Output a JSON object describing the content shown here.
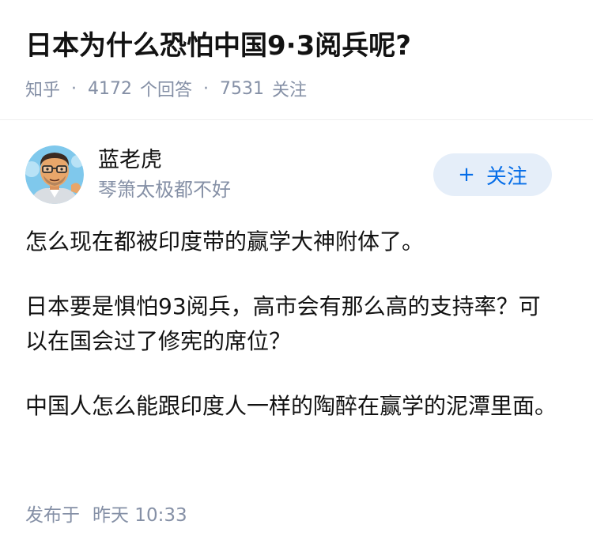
{
  "question": {
    "title": "日本为什么恐怕中国9·3阅兵呢?",
    "source": "知乎",
    "separator": "·",
    "answer_count": "4172",
    "answer_label": "个回答",
    "follower_count": "7531",
    "follower_label": "关注"
  },
  "author": {
    "name": "蓝老虎",
    "bio": "琴箫太极都不好",
    "avatar_icon": "cartoon-avatar-icon"
  },
  "follow_button": {
    "plus": "+",
    "label": "关注"
  },
  "answer": {
    "paragraphs": [
      "怎么现在都被印度带的赢学大神附体了。",
      "日本要是惧怕93阅兵，高市会有那么高的支持率？可以在国会过了修宪的席位？",
      "中国人怎么能跟印度人一样的陶醉在赢学的泥潭里面。"
    ],
    "published_label": "发布于",
    "published_time": "昨天 10:33"
  },
  "colors": {
    "text": "#121212",
    "meta": "#8590a6",
    "accent": "#056de8",
    "button_bg": "#e5eef9"
  }
}
